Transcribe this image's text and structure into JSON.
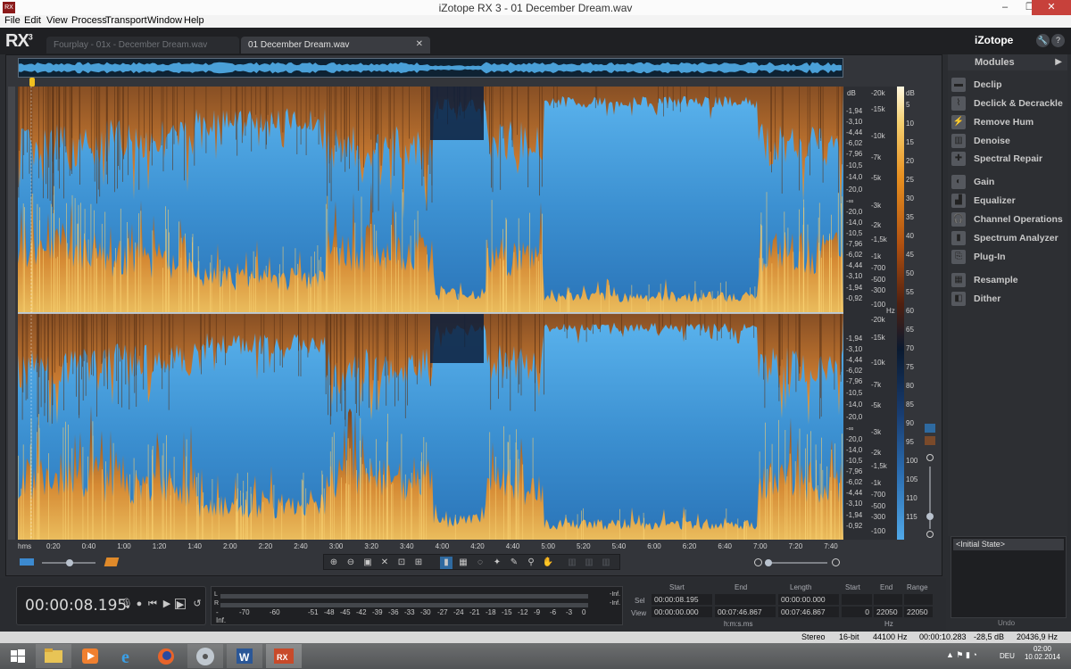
{
  "window": {
    "title": "iZotope RX 3 - 01 December Dream.wav",
    "minimize": "–",
    "maximize": "❐",
    "close": "✕",
    "appicon": "RX"
  },
  "menu": [
    "File",
    "Edit",
    "View",
    "Process",
    "Transport",
    "Window",
    "Help"
  ],
  "header": {
    "logo": "RX",
    "logo_sup": "3",
    "tabs": [
      {
        "label": "Fourplay - 01x - December Dream.wav",
        "active": false
      },
      {
        "label": "01 December Dream.wav",
        "active": true
      }
    ],
    "close_tab": "✕",
    "brand": "iZotope",
    "settings_icon": "🔧",
    "help_icon": "?"
  },
  "db_scale": {
    "top_header": "dB",
    "top_ch": [
      "-1,94",
      "-3,10",
      "-4,44",
      "-6,02",
      "-7,96",
      "-10,5",
      "-14,0",
      "-20,0",
      "-∞",
      "-20,0",
      "-14,0",
      "-10,5",
      "-7,96",
      "-6,02",
      "-4,44",
      "-3,10",
      "-1,94",
      "-0,92"
    ],
    "bottom_ch": [
      "-1,94",
      "-3,10",
      "-4,44",
      "-6,02",
      "-7,96",
      "-10,5",
      "-14,0",
      "-20,0",
      "-∞",
      "-20,0",
      "-14,0",
      "-10,5",
      "-7,96",
      "-6,02",
      "-4,44",
      "-3,10",
      "-1,94",
      "-0,92"
    ]
  },
  "hz_scale": {
    "top": [
      "-20k",
      "-15k",
      "-10k",
      "-7k",
      "-5k",
      "-3k",
      "-2k",
      "-1,5k",
      "-1k",
      "-700",
      "-500",
      "-300",
      "-100"
    ],
    "bottom": [
      "-20k",
      "-15k",
      "-10k",
      "-7k",
      "-5k",
      "-3k",
      "-2k",
      "-1,5k",
      "-1k",
      "-700",
      "-500",
      "-300",
      "-100"
    ],
    "unit": "Hz"
  },
  "colorbar_scale": {
    "header": "dB",
    "labels": [
      "5",
      "10",
      "15",
      "20",
      "25",
      "30",
      "35",
      "40",
      "45",
      "50",
      "55",
      "60",
      "65",
      "70",
      "75",
      "80",
      "85",
      "90",
      "95",
      "100",
      "105",
      "110",
      "115"
    ]
  },
  "time_axis": {
    "unit": "hms",
    "labels": [
      "0:20",
      "0:40",
      "1:00",
      "1:20",
      "1:40",
      "2:00",
      "2:20",
      "2:40",
      "3:00",
      "3:20",
      "3:40",
      "4:00",
      "4:20",
      "4:40",
      "5:00",
      "5:20",
      "5:40",
      "6:00",
      "6:20",
      "6:40",
      "7:00",
      "7:20",
      "7:40"
    ]
  },
  "toolbar_icons": [
    "zoom-in-icon",
    "zoom-out-icon",
    "zoom-select-icon",
    "zoom-x-icon",
    "zoom-fit-icon",
    "zoom-all-icon",
    "time-select-icon",
    "rect-select-icon",
    "lasso-icon",
    "wand-icon",
    "brush-icon",
    "zoom-tool-icon",
    "hand-icon",
    "grid-1-icon",
    "grid-2-icon",
    "grid-3-icon"
  ],
  "modules": {
    "header": "Modules",
    "arrow": "▶",
    "items": [
      {
        "label": "Declip",
        "icon": "declip-icon"
      },
      {
        "label": "Declick & Decrackle",
        "icon": "declick-icon"
      },
      {
        "label": "Remove Hum",
        "icon": "hum-icon"
      },
      {
        "label": "Denoise",
        "icon": "denoise-icon"
      },
      {
        "label": "Spectral Repair",
        "icon": "spectral-repair-icon"
      },
      {
        "label": "Gain",
        "icon": "gain-icon"
      },
      {
        "label": "Equalizer",
        "icon": "equalizer-icon"
      },
      {
        "label": "Channel Operations",
        "icon": "channel-ops-icon"
      },
      {
        "label": "Spectrum Analyzer",
        "icon": "spectrum-icon"
      },
      {
        "label": "Plug-In",
        "icon": "plugin-icon"
      },
      {
        "label": "Resample",
        "icon": "resample-icon"
      },
      {
        "label": "Dither",
        "icon": "dither-icon"
      }
    ]
  },
  "undo": {
    "items": [
      "<Initial State>"
    ],
    "label": "Undo"
  },
  "transport": {
    "timecode": "00:00:08.195",
    "meter_L": "L",
    "meter_R": "R",
    "meter_inf_top": "-Inf.",
    "meter_inf_bot": "-Inf.",
    "meter_labels": [
      "-Inf.",
      "-70",
      "-60",
      "-51",
      "-48",
      "-45",
      "-42",
      "-39",
      "-36",
      "-33",
      "-30",
      "-27",
      "-24",
      "-21",
      "-18",
      "-15",
      "-12",
      "-9",
      "-6",
      "-3",
      "0"
    ]
  },
  "selection": {
    "headers": {
      "start": "Start",
      "end": "End",
      "length": "Length",
      "hz_start": "Start",
      "hz_end": "End",
      "range": "Range"
    },
    "sel_label": "Sel",
    "view_label": "View",
    "sel": {
      "start": "00:00:08.195",
      "end": "",
      "length": "00:00:00.000",
      "hz_start": "",
      "hz_end": "",
      "range": ""
    },
    "view": {
      "start": "00:00:00.000",
      "end": "00:07:46.867",
      "length": "00:07:46.867",
      "hz_start": "0",
      "hz_end": "22050",
      "range": "22050"
    },
    "unit_time": "h:m:s.ms",
    "unit_hz": "Hz"
  },
  "status": {
    "items": [
      "Stereo",
      "16-bit",
      "44100 Hz",
      "00:00:10.283",
      "-28,5 dB",
      "20436,9 Hz"
    ]
  },
  "taskbar": {
    "clock_time": "02:00",
    "clock_date": "10.02.2014",
    "lang": "DEU"
  },
  "colors": {
    "accent_blue": "#2f86c8",
    "spectro_orange": "#e07a20",
    "playhead": "#f0c020"
  }
}
